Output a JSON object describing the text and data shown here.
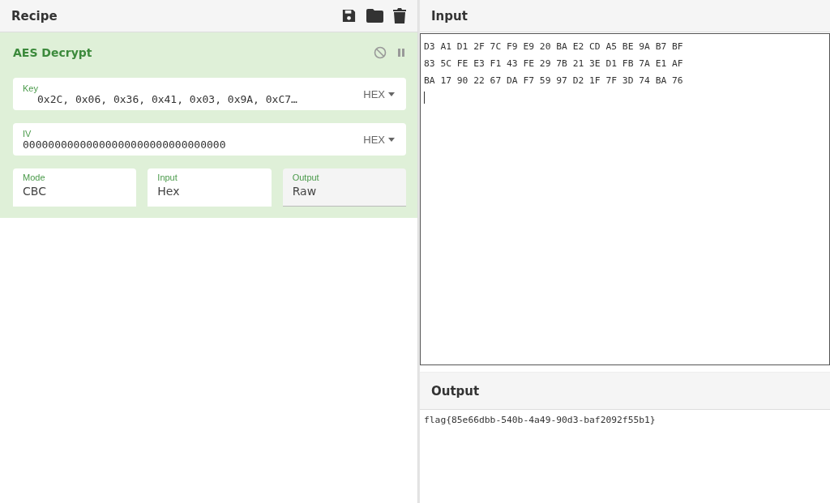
{
  "recipe": {
    "title": "Recipe",
    "operation": {
      "name": "AES Decrypt",
      "disabled": false,
      "paused": false,
      "inputs": [
        {
          "label": "Key",
          "value": "0x2C, 0x06, 0x36, 0x41, 0x03, 0x9A, 0xC7…",
          "format": "HEX"
        },
        {
          "label": "IV",
          "value": "00000000000000000000000000000000",
          "format": "HEX"
        }
      ],
      "options": [
        {
          "label": "Mode",
          "value": "CBC",
          "selected": false
        },
        {
          "label": "Input",
          "value": "Hex",
          "selected": false
        },
        {
          "label": "Output",
          "value": "Raw",
          "selected": true
        }
      ]
    }
  },
  "input": {
    "title": "Input",
    "lines": [
      "D3 A1 D1 2F 7C F9 E9 20 BA E2 CD A5 BE 9A B7 BF",
      "83 5C FE E3 F1 43 FE 29 7B 21 3E D1 FB 7A E1 AF",
      "BA 17 90 22 67 DA F7 59 97 D2 1F 7F 3D 74 BA 76"
    ]
  },
  "output": {
    "title": "Output",
    "text": "flag{85e66dbb-540b-4a49-90d3-baf2092f55b1}"
  }
}
